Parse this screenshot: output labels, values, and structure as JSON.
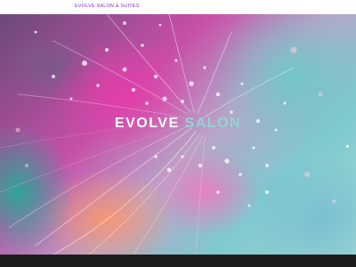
{
  "header": {
    "brand_link": "EVOLVE SALON & SUITES"
  },
  "hero": {
    "title_word_1": "EVOLVE",
    "title_word_2": "SALON"
  },
  "colors": {
    "brand": "#8a2fc9",
    "title_white": "#ffffff",
    "title_accent": "#8fd6d0",
    "footer": "#1c1c1c"
  }
}
